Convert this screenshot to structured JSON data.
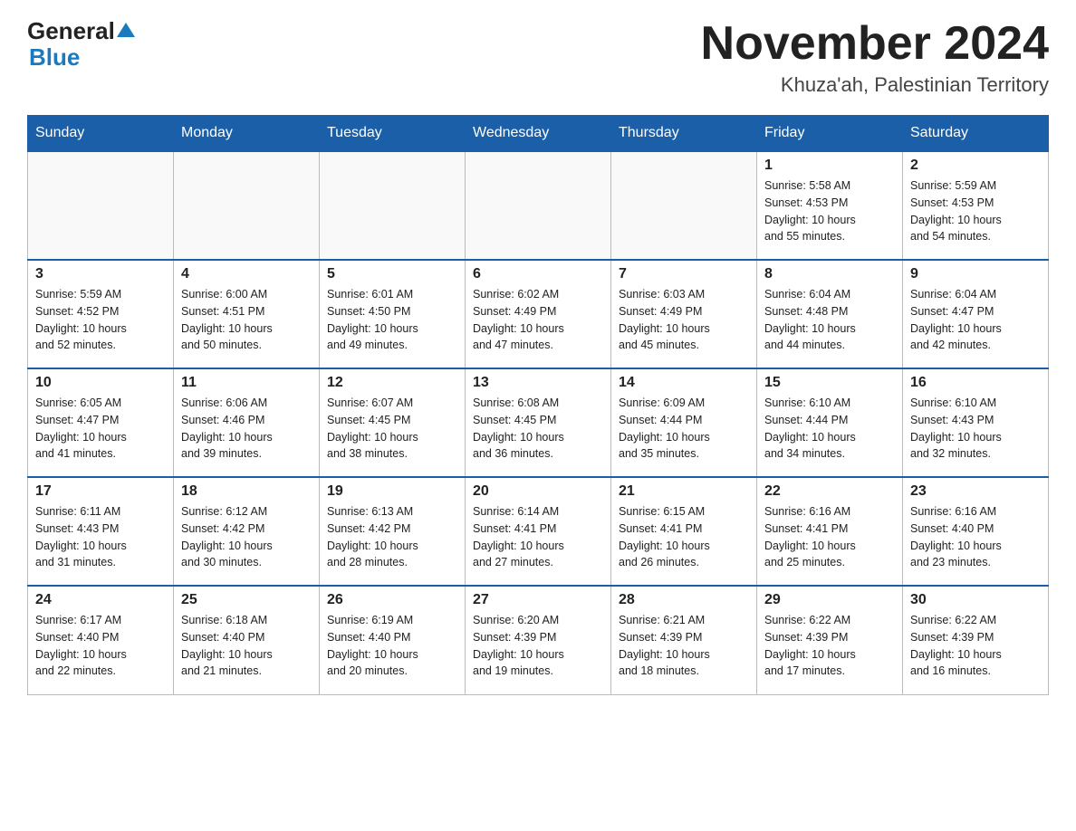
{
  "header": {
    "logo_general": "General",
    "logo_blue": "Blue",
    "month_title": "November 2024",
    "location": "Khuza'ah, Palestinian Territory"
  },
  "weekdays": [
    "Sunday",
    "Monday",
    "Tuesday",
    "Wednesday",
    "Thursday",
    "Friday",
    "Saturday"
  ],
  "weeks": [
    [
      {
        "day": "",
        "info": ""
      },
      {
        "day": "",
        "info": ""
      },
      {
        "day": "",
        "info": ""
      },
      {
        "day": "",
        "info": ""
      },
      {
        "day": "",
        "info": ""
      },
      {
        "day": "1",
        "info": "Sunrise: 5:58 AM\nSunset: 4:53 PM\nDaylight: 10 hours\nand 55 minutes."
      },
      {
        "day": "2",
        "info": "Sunrise: 5:59 AM\nSunset: 4:53 PM\nDaylight: 10 hours\nand 54 minutes."
      }
    ],
    [
      {
        "day": "3",
        "info": "Sunrise: 5:59 AM\nSunset: 4:52 PM\nDaylight: 10 hours\nand 52 minutes."
      },
      {
        "day": "4",
        "info": "Sunrise: 6:00 AM\nSunset: 4:51 PM\nDaylight: 10 hours\nand 50 minutes."
      },
      {
        "day": "5",
        "info": "Sunrise: 6:01 AM\nSunset: 4:50 PM\nDaylight: 10 hours\nand 49 minutes."
      },
      {
        "day": "6",
        "info": "Sunrise: 6:02 AM\nSunset: 4:49 PM\nDaylight: 10 hours\nand 47 minutes."
      },
      {
        "day": "7",
        "info": "Sunrise: 6:03 AM\nSunset: 4:49 PM\nDaylight: 10 hours\nand 45 minutes."
      },
      {
        "day": "8",
        "info": "Sunrise: 6:04 AM\nSunset: 4:48 PM\nDaylight: 10 hours\nand 44 minutes."
      },
      {
        "day": "9",
        "info": "Sunrise: 6:04 AM\nSunset: 4:47 PM\nDaylight: 10 hours\nand 42 minutes."
      }
    ],
    [
      {
        "day": "10",
        "info": "Sunrise: 6:05 AM\nSunset: 4:47 PM\nDaylight: 10 hours\nand 41 minutes."
      },
      {
        "day": "11",
        "info": "Sunrise: 6:06 AM\nSunset: 4:46 PM\nDaylight: 10 hours\nand 39 minutes."
      },
      {
        "day": "12",
        "info": "Sunrise: 6:07 AM\nSunset: 4:45 PM\nDaylight: 10 hours\nand 38 minutes."
      },
      {
        "day": "13",
        "info": "Sunrise: 6:08 AM\nSunset: 4:45 PM\nDaylight: 10 hours\nand 36 minutes."
      },
      {
        "day": "14",
        "info": "Sunrise: 6:09 AM\nSunset: 4:44 PM\nDaylight: 10 hours\nand 35 minutes."
      },
      {
        "day": "15",
        "info": "Sunrise: 6:10 AM\nSunset: 4:44 PM\nDaylight: 10 hours\nand 34 minutes."
      },
      {
        "day": "16",
        "info": "Sunrise: 6:10 AM\nSunset: 4:43 PM\nDaylight: 10 hours\nand 32 minutes."
      }
    ],
    [
      {
        "day": "17",
        "info": "Sunrise: 6:11 AM\nSunset: 4:43 PM\nDaylight: 10 hours\nand 31 minutes."
      },
      {
        "day": "18",
        "info": "Sunrise: 6:12 AM\nSunset: 4:42 PM\nDaylight: 10 hours\nand 30 minutes."
      },
      {
        "day": "19",
        "info": "Sunrise: 6:13 AM\nSunset: 4:42 PM\nDaylight: 10 hours\nand 28 minutes."
      },
      {
        "day": "20",
        "info": "Sunrise: 6:14 AM\nSunset: 4:41 PM\nDaylight: 10 hours\nand 27 minutes."
      },
      {
        "day": "21",
        "info": "Sunrise: 6:15 AM\nSunset: 4:41 PM\nDaylight: 10 hours\nand 26 minutes."
      },
      {
        "day": "22",
        "info": "Sunrise: 6:16 AM\nSunset: 4:41 PM\nDaylight: 10 hours\nand 25 minutes."
      },
      {
        "day": "23",
        "info": "Sunrise: 6:16 AM\nSunset: 4:40 PM\nDaylight: 10 hours\nand 23 minutes."
      }
    ],
    [
      {
        "day": "24",
        "info": "Sunrise: 6:17 AM\nSunset: 4:40 PM\nDaylight: 10 hours\nand 22 minutes."
      },
      {
        "day": "25",
        "info": "Sunrise: 6:18 AM\nSunset: 4:40 PM\nDaylight: 10 hours\nand 21 minutes."
      },
      {
        "day": "26",
        "info": "Sunrise: 6:19 AM\nSunset: 4:40 PM\nDaylight: 10 hours\nand 20 minutes."
      },
      {
        "day": "27",
        "info": "Sunrise: 6:20 AM\nSunset: 4:39 PM\nDaylight: 10 hours\nand 19 minutes."
      },
      {
        "day": "28",
        "info": "Sunrise: 6:21 AM\nSunset: 4:39 PM\nDaylight: 10 hours\nand 18 minutes."
      },
      {
        "day": "29",
        "info": "Sunrise: 6:22 AM\nSunset: 4:39 PM\nDaylight: 10 hours\nand 17 minutes."
      },
      {
        "day": "30",
        "info": "Sunrise: 6:22 AM\nSunset: 4:39 PM\nDaylight: 10 hours\nand 16 minutes."
      }
    ]
  ]
}
